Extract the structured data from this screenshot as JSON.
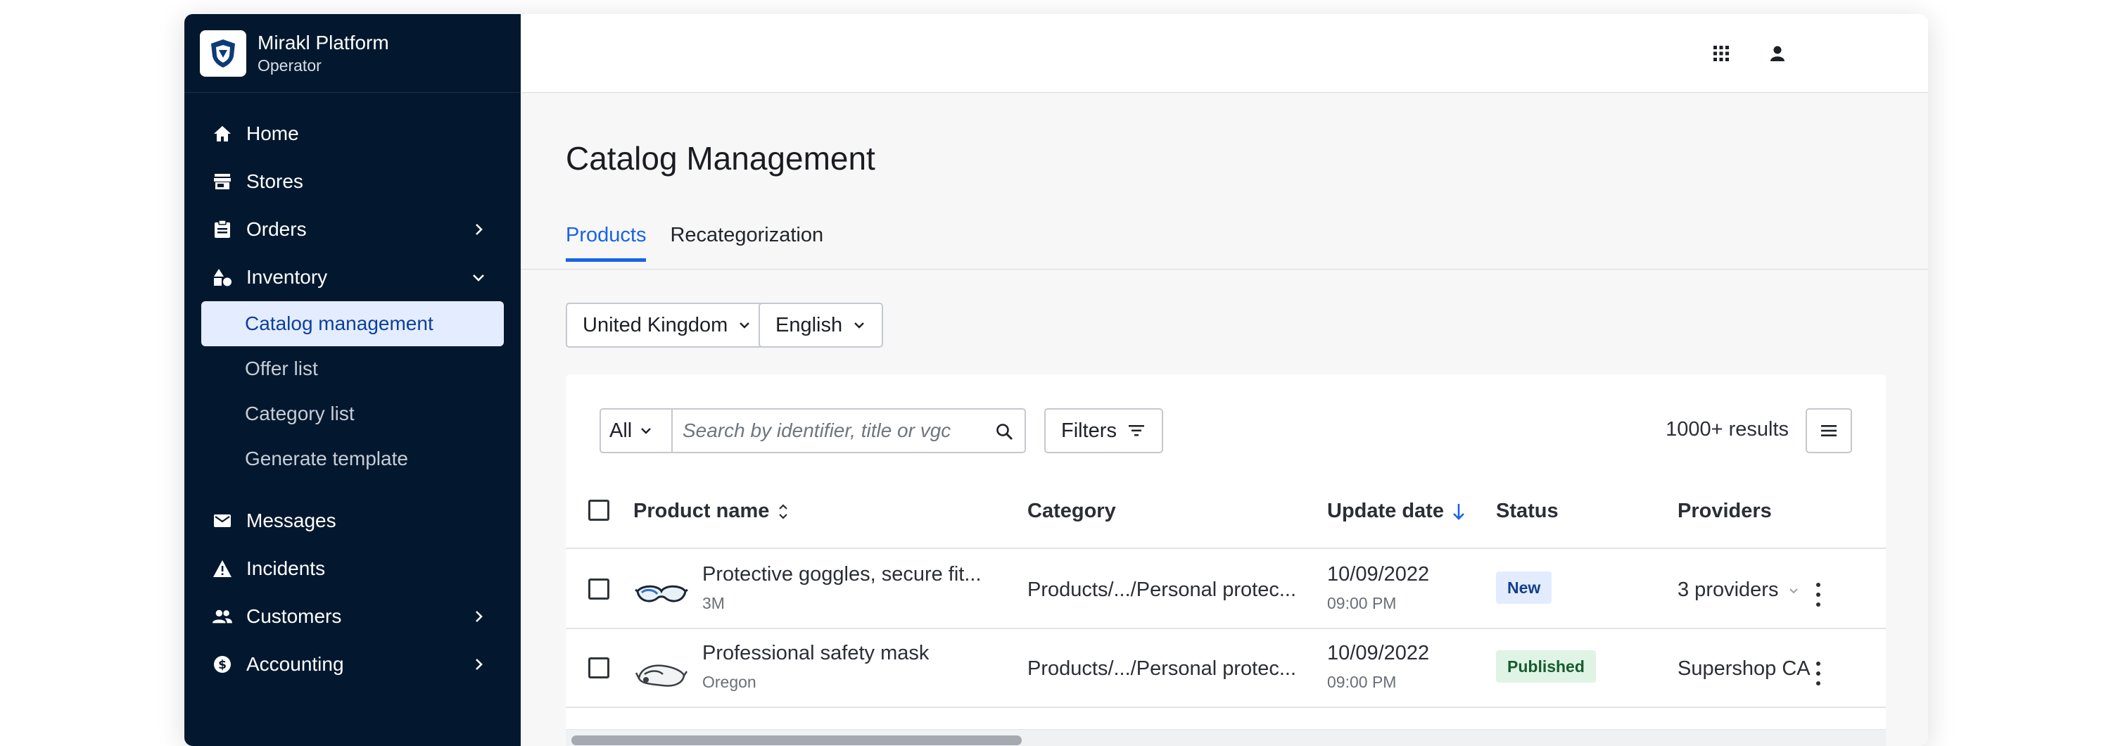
{
  "app": {
    "name": "Mirakl Platform",
    "role": "Operator"
  },
  "sidebar": {
    "items": [
      {
        "label": "Home",
        "icon": "home-icon"
      },
      {
        "label": "Stores",
        "icon": "store-icon"
      },
      {
        "label": "Orders",
        "icon": "clipboard-icon",
        "chevron": "right"
      },
      {
        "label": "Inventory",
        "icon": "shapes-icon",
        "chevron": "down"
      }
    ],
    "inventory_sub": [
      {
        "label": "Catalog management",
        "active": true
      },
      {
        "label": "Offer list"
      },
      {
        "label": "Category list"
      },
      {
        "label": "Generate template"
      }
    ],
    "bottom_items": [
      {
        "label": "Messages",
        "icon": "mail-icon"
      },
      {
        "label": "Incidents",
        "icon": "warning-icon"
      },
      {
        "label": "Customers",
        "icon": "people-icon",
        "chevron": "right"
      },
      {
        "label": "Accounting",
        "icon": "dollar-icon",
        "chevron": "right"
      }
    ]
  },
  "topbar": {
    "icons": [
      "apps-grid-icon",
      "user-icon"
    ]
  },
  "page": {
    "title": "Catalog Management",
    "tabs": [
      {
        "label": "Products",
        "active": true
      },
      {
        "label": "Recategorization"
      }
    ],
    "country_select": "United Kingdom",
    "language_select": "English"
  },
  "table_toolbar": {
    "scope_select": "All",
    "search_placeholder": "Search by identifier, title or vgc",
    "search_value": "",
    "filters_label": "Filters",
    "results": "1000+ results"
  },
  "table": {
    "columns": [
      "Product name",
      "Category",
      "Update date",
      "Status",
      "Providers"
    ],
    "sort": {
      "column": "Update date",
      "direction": "desc"
    },
    "rows": [
      {
        "name": "Protective goggles, secure fit...",
        "brand": "3M",
        "category": "Products/.../Personal protec...",
        "date": "10/09/2022",
        "time": "09:00 PM",
        "status": "New",
        "status_color": "#e3ecff",
        "providers": "3 providers",
        "providers_dropdown": true
      },
      {
        "name": "Professional safety mask",
        "brand": "Oregon",
        "category": "Products/.../Personal protec...",
        "date": "10/09/2022",
        "time": "09:00 PM",
        "status": "Published",
        "status_color": "#dff4e4",
        "providers": "Supershop CA",
        "providers_dropdown": false
      }
    ]
  },
  "colors": {
    "sidebar_bg": "#03182f",
    "accent": "#1863e8",
    "active_item_bg": "#e4edff"
  }
}
